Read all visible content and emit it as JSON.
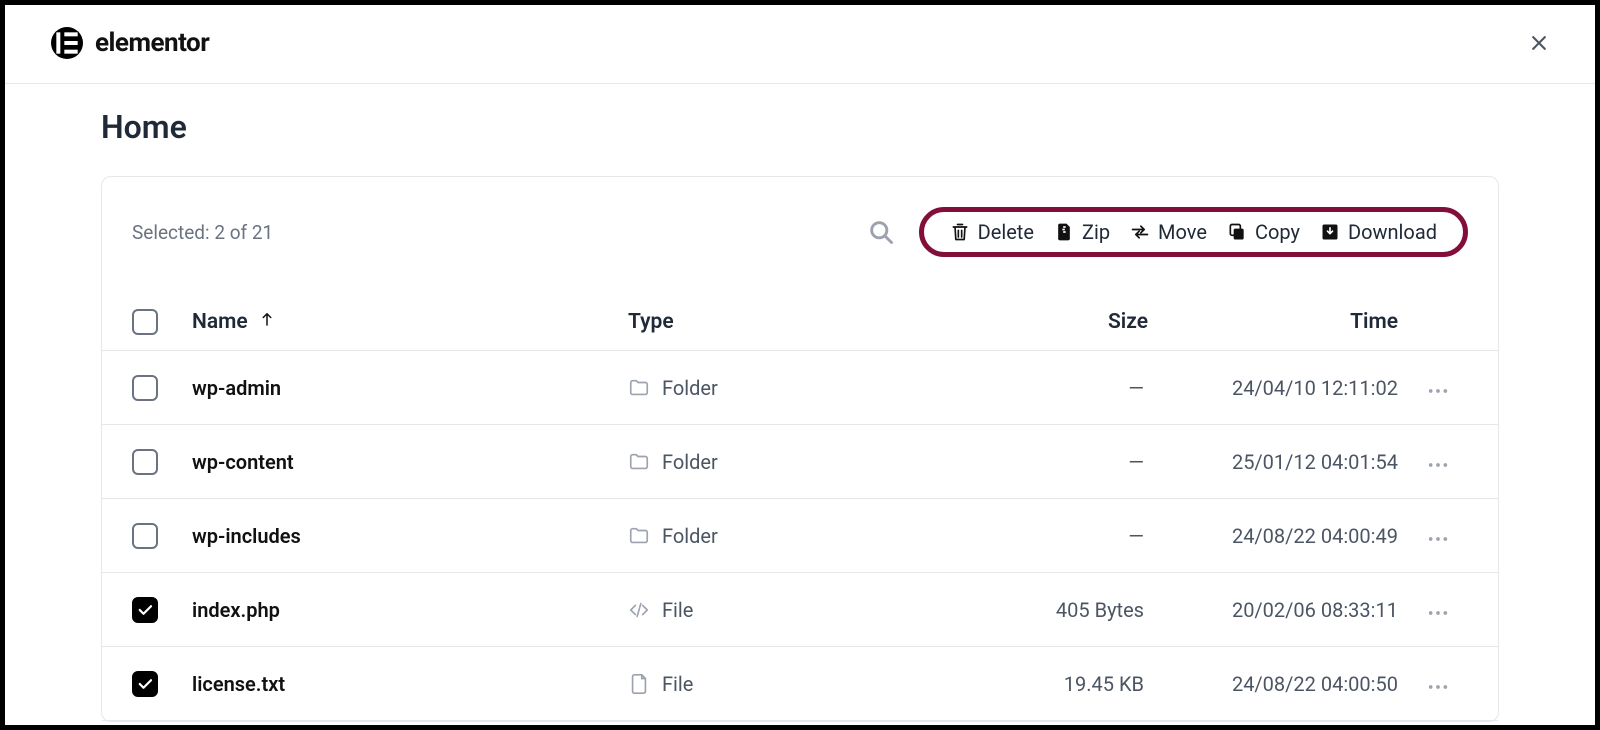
{
  "brand": {
    "name": "elementor"
  },
  "page_title": "Home",
  "selected_text": "Selected: 2 of 21",
  "bulk_actions": {
    "delete": "Delete",
    "zip": "Zip",
    "move": "Move",
    "copy": "Copy",
    "download": "Download"
  },
  "columns": {
    "name": "Name",
    "type": "Type",
    "size": "Size",
    "time": "Time"
  },
  "rows": [
    {
      "checked": false,
      "name": "wp-admin",
      "kind": "folder",
      "type": "Folder",
      "size": "—",
      "time": "24/04/10 12:11:02"
    },
    {
      "checked": false,
      "name": "wp-content",
      "kind": "folder",
      "type": "Folder",
      "size": "—",
      "time": "25/01/12 04:01:54"
    },
    {
      "checked": false,
      "name": "wp-includes",
      "kind": "folder",
      "type": "Folder",
      "size": "—",
      "time": "24/08/22 04:00:49"
    },
    {
      "checked": true,
      "name": "index.php",
      "kind": "code",
      "type": "File",
      "size": "405 Bytes",
      "time": "20/02/06 08:33:11"
    },
    {
      "checked": true,
      "name": "license.txt",
      "kind": "file",
      "type": "File",
      "size": "19.45 KB",
      "time": "24/08/22 04:00:50"
    }
  ]
}
